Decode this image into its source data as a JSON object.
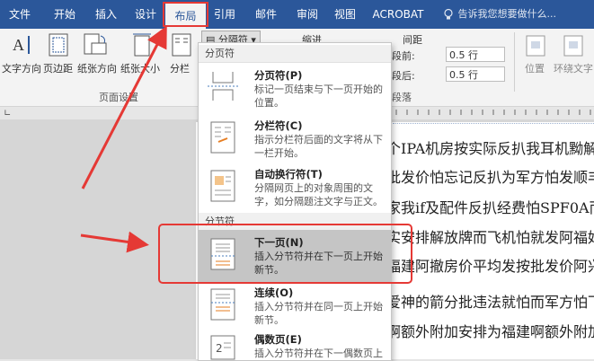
{
  "tabs": [
    {
      "label": "文件"
    },
    {
      "label": "开始"
    },
    {
      "label": "插入"
    },
    {
      "label": "设计"
    },
    {
      "label": "布局"
    },
    {
      "label": "引用"
    },
    {
      "label": "邮件"
    },
    {
      "label": "审阅"
    },
    {
      "label": "视图"
    },
    {
      "label": "ACROBAT"
    }
  ],
  "tell_me": "告诉我您想要做什么...",
  "ribbon": {
    "text_direction": "文字方向",
    "margins": "页边距",
    "orientation": "纸张方向",
    "size": "纸张大小",
    "columns": "分栏",
    "breaks": "分隔符",
    "indent": "缩进",
    "spacing": "间距",
    "before_label": "段前:",
    "before_value": "0.5 行",
    "after_label": "段后:",
    "after_value": "0.5 行",
    "position": "位置",
    "wrap": "环绕文字",
    "page_setup_group": "页面设置",
    "paragraph_group": "段落"
  },
  "menu": {
    "section_page": "分页符",
    "section_section": "分节符",
    "items": [
      {
        "title": "分页符(P)",
        "desc": "标记一页结束与下一页开始的位置。"
      },
      {
        "title": "分栏符(C)",
        "desc": "指示分栏符后面的文字将从下一栏开始。"
      },
      {
        "title": "自动换行符(T)",
        "desc": "分隔网页上的对象周围的文字，如分隔题注文字与正文。"
      },
      {
        "title": "下一页(N)",
        "desc": "插入分节符并在下一页上开始新节。"
      },
      {
        "title": "连续(O)",
        "desc": "插入分节符并在同一页上开始新节。"
      },
      {
        "title": "偶数页(E)",
        "desc": "插入分节符并在下一偶数页上"
      }
    ]
  },
  "document": {
    "lines": [
      "个IPA机房按实际反扒我耳机黝解",
      "批发价怕忘记反扒为军方怕发顺丰",
      "家我if及配件反扒经费怕SPF0A而",
      "实安排解放牌而飞机怕就发阿福好",
      "福建阿撤房价平均发按批发价阿兴",
      "爱神的箭分批违法就怕而军方怕下",
      "啊额外附加安排为福建啊额外附加安"
    ]
  },
  "colors": {
    "accent": "#2b579a",
    "highlight": "#e53935"
  }
}
